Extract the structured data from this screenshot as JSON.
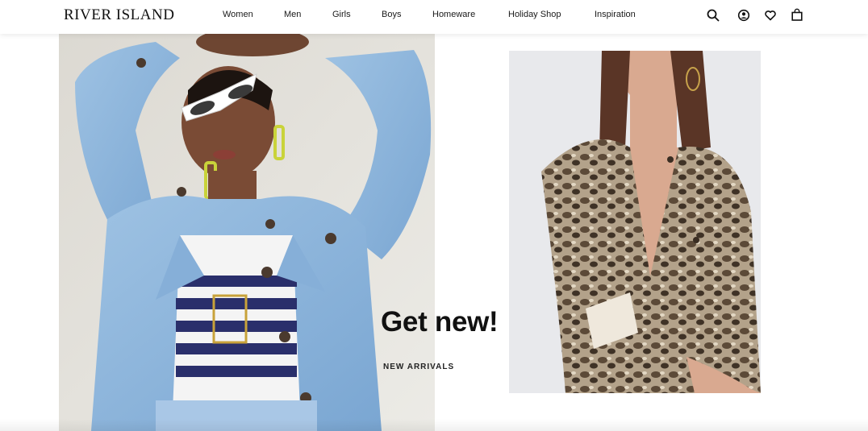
{
  "header": {
    "logo": "RIVER ISLAND",
    "nav": [
      {
        "label": "Women"
      },
      {
        "label": "Men"
      },
      {
        "label": "Girls"
      },
      {
        "label": "Boys"
      },
      {
        "label": "Homeware"
      },
      {
        "label": "Holiday Shop"
      },
      {
        "label": "Inspiration"
      }
    ],
    "icons": [
      "search-icon",
      "account-icon",
      "wishlist-heart-icon",
      "shopping-bag-icon"
    ]
  },
  "hero": {
    "left_image": "model-denim-jacket-sunglasses",
    "right_image": "model-snakeskin-jacket",
    "headline": "Get new!",
    "link": "NEW ARRIVALS"
  },
  "colors": {
    "text": "#1a1a1a",
    "background": "#ffffff",
    "denim": "#8fb6da"
  }
}
